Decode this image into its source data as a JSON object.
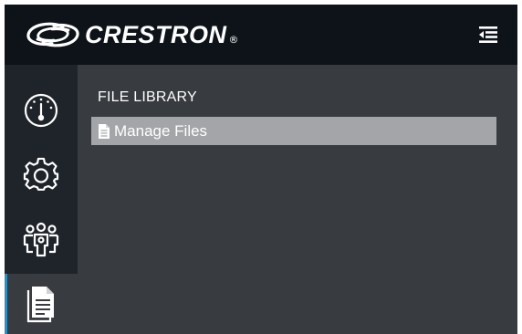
{
  "header": {
    "brand": "CRESTRON",
    "reg_mark": "®",
    "menu_icon": "collapse-menu-icon"
  },
  "sidebar": {
    "items": [
      {
        "icon": "dashboard-gauge-icon",
        "active": false
      },
      {
        "icon": "gear-icon",
        "active": false
      },
      {
        "icon": "users-group-icon",
        "active": false
      },
      {
        "icon": "document-icon",
        "active": true
      }
    ],
    "active_accent": "#2a8fc7"
  },
  "main": {
    "section_title": "FILE LIBRARY",
    "items": [
      {
        "label": "Manage Files",
        "icon": "file-icon"
      }
    ]
  },
  "colors": {
    "header_bg": "#0d1319",
    "sidebar_bg": "#1f242a",
    "content_bg": "#383b40",
    "selected_item_bg": "#a3a5a8"
  }
}
